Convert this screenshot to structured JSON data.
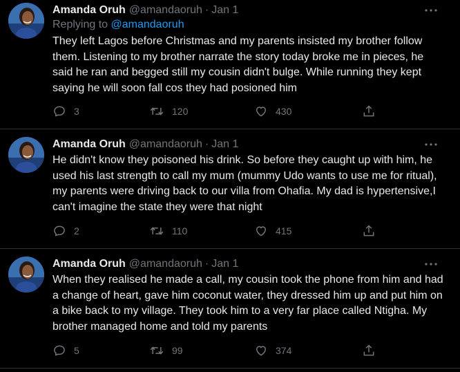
{
  "colors": {
    "background": "#000000",
    "text": "#e7e9ea",
    "secondary": "#71767b",
    "link": "#1d9bf0",
    "divider": "#2f3336"
  },
  "tweets": [
    {
      "name": "Amanda Oruh",
      "handle": "@amandaoruh",
      "separator": "·",
      "date": "Jan 1",
      "reply_prefix": "Replying to",
      "reply_mention": "@amandaoruh",
      "text": "They left Lagos before Christmas and my parents insisted my brother follow them. Listening to my brother narrate the story today broke me in pieces, he said he ran and begged still my cousin didn't bulge. While running they kept saying he will soon fall cos they had posioned him",
      "replies": "3",
      "retweets": "120",
      "likes": "430"
    },
    {
      "name": "Amanda Oruh",
      "handle": "@amandaoruh",
      "separator": "·",
      "date": "Jan 1",
      "text": "He didn't know they poisoned his drink. So before they caught up with him, he used his last strength to call my mum (mummy Udo wants to use me for ritual), my parents were driving back to our villa from Ohafia. My dad is hypertensive,I can't imagine the state they were that night",
      "replies": "2",
      "retweets": "110",
      "likes": "415"
    },
    {
      "name": "Amanda Oruh",
      "handle": "@amandaoruh",
      "separator": "·",
      "date": "Jan 1",
      "text": "When they realised he made a call, my cousin took the phone from him and had a change of heart, gave him coconut water, they dressed him up and put him on a bike back to my village. They took him to a very far place called Ntigha. My brother managed home and told my parents",
      "replies": "5",
      "retweets": "99",
      "likes": "374"
    }
  ],
  "icons": {
    "avatar": "profile-photo",
    "more": "more-dots-icon",
    "reply": "reply-bubble-icon",
    "retweet": "retweet-arrows-icon",
    "like": "heart-icon",
    "share": "share-upload-icon"
  }
}
